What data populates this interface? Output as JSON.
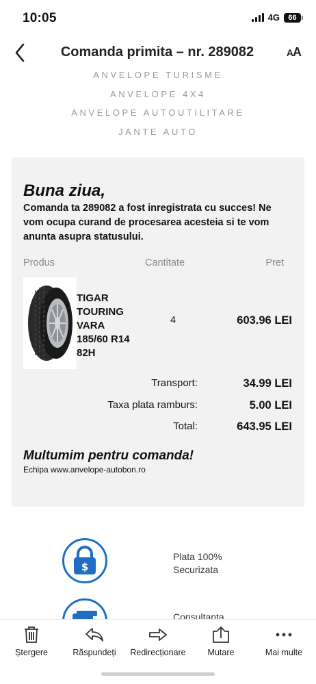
{
  "status_bar": {
    "time": "10:05",
    "network": "4G",
    "battery": "66"
  },
  "nav": {
    "title": "Comanda primita – nr. 289082",
    "text_size_label_small": "A",
    "text_size_label_big": "A"
  },
  "categories": [
    "ANVELOPE TURISME",
    "ANVELOPE 4X4",
    "ANVELOPE AUTOUTILITARE",
    "JANTE AUTO"
  ],
  "email": {
    "greeting": "Buna ziua,",
    "intro": "Comanda ta 289082 a fost inregistrata cu succes! Ne vom ocupa curand de procesarea acesteia si te vom anunta asupra statusului.",
    "table_headers": {
      "product": "Produs",
      "quantity": "Cantitate",
      "price": "Pret"
    },
    "product": {
      "name_line1": "TIGAR",
      "name_line2": "TOURING",
      "name_line3": "VARA",
      "name_line4": "185/60 R14",
      "name_line5": "82H",
      "quantity": "4",
      "price": "603.96 LEI"
    },
    "summary": {
      "transport_label": "Transport:",
      "transport_value": "34.99 LEI",
      "fee_label": "Taxa plata ramburs:",
      "fee_value": "5.00 LEI",
      "total_label": "Total:",
      "total_value": "643.95 LEI"
    },
    "thanks": "Multumim pentru comanda!",
    "team": "Echipa www.anvelope-autobon.ro"
  },
  "features": [
    {
      "text": "Plata 100% Securizata",
      "icon": "padlock-dollar-icon"
    },
    {
      "text": "Consultanta",
      "icon": "card-icon"
    }
  ],
  "toolbar": [
    {
      "label": "Ștergere",
      "icon": "trash-icon"
    },
    {
      "label": "Răspundeți",
      "icon": "reply-icon"
    },
    {
      "label": "Redirecționare",
      "icon": "forward-icon"
    },
    {
      "label": "Mutare",
      "icon": "move-icon"
    },
    {
      "label": "Mai multe",
      "icon": "more-icon"
    }
  ],
  "colors": {
    "accent": "#1f6ec3",
    "card_bg": "#f2f2f2",
    "muted_text": "#9a9a9a"
  }
}
